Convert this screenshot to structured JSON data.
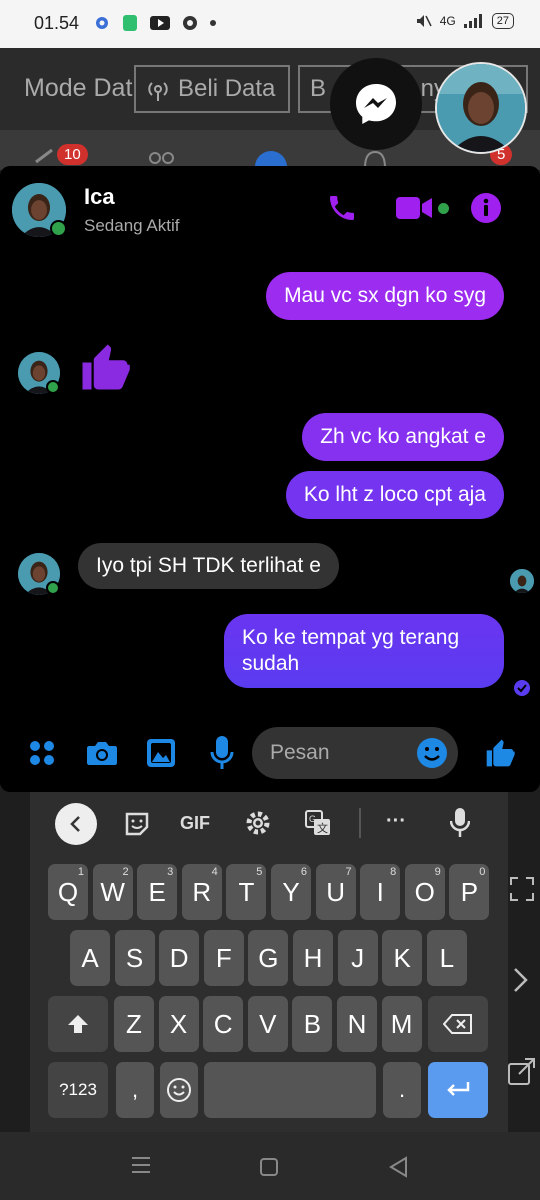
{
  "status_bar": {
    "time": "01.54",
    "battery": "27",
    "network": "4G"
  },
  "background_app": {
    "mode_text": "Mode Dat",
    "buy_button": "Beli Data",
    "other_button": "B",
    "other_button_tail": "ny",
    "tab_badge_left": "10",
    "tab_badge_right": "5"
  },
  "chat": {
    "contact_name": "Ica",
    "contact_status": "Sedang Aktif",
    "messages": [
      {
        "from": "me",
        "text": "Mau vc sx dgn ko syg"
      },
      {
        "from": "them",
        "type": "like"
      },
      {
        "from": "me",
        "text": "Zh vc ko angkat e"
      },
      {
        "from": "me",
        "text": "Ko lht z loco cpt aja"
      },
      {
        "from": "them",
        "text": "Iyo tpi SH TDK terlihat e"
      },
      {
        "from": "me",
        "text": "Ko ke tempat yg terang sudah"
      }
    ],
    "input_placeholder": "Pesan"
  },
  "keyboard": {
    "toolbar": {
      "gif": "GIF",
      "more": "···"
    },
    "row1": [
      {
        "k": "Q",
        "n": "1"
      },
      {
        "k": "W",
        "n": "2"
      },
      {
        "k": "E",
        "n": "3"
      },
      {
        "k": "R",
        "n": "4"
      },
      {
        "k": "T",
        "n": "5"
      },
      {
        "k": "Y",
        "n": "6"
      },
      {
        "k": "U",
        "n": "7"
      },
      {
        "k": "I",
        "n": "8"
      },
      {
        "k": "O",
        "n": "9"
      },
      {
        "k": "P",
        "n": "0"
      }
    ],
    "row2": [
      "A",
      "S",
      "D",
      "F",
      "G",
      "H",
      "J",
      "K",
      "L"
    ],
    "row3": [
      "Z",
      "X",
      "C",
      "V",
      "B",
      "N",
      "M"
    ],
    "numbers_key": "?123",
    "comma": ",",
    "period": "."
  },
  "colors": {
    "accent_purple": "#a020f0",
    "bubble_gradient_top": "#9b2cf0",
    "bubble_gradient_bottom": "#5a3cf0",
    "icon_blue": "#1e88e5",
    "online_green": "#31a24c"
  }
}
